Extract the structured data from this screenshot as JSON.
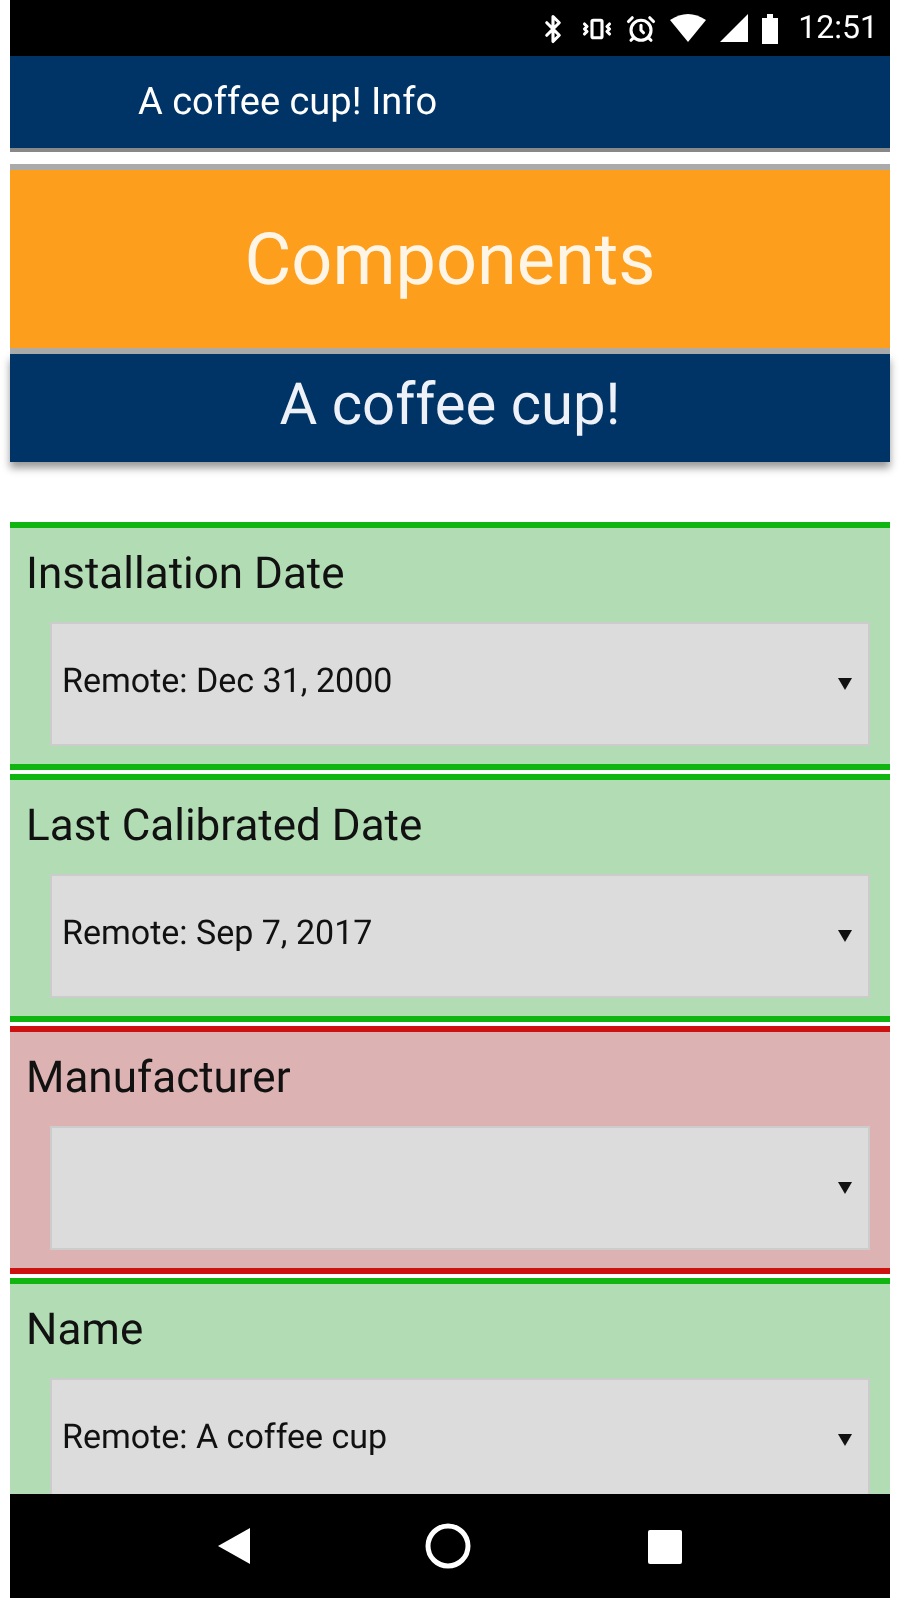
{
  "status_bar": {
    "time": "12:51"
  },
  "app_bar": {
    "title": "A coffee cup! Info"
  },
  "category_banner": {
    "title": "Components"
  },
  "item_banner": {
    "title": "A coffee cup!"
  },
  "fields": [
    {
      "label": "Installation Date",
      "value": "Remote: Dec 31, 2000",
      "valid": true
    },
    {
      "label": "Last Calibrated Date",
      "value": "Remote: Sep 7, 2017",
      "valid": true
    },
    {
      "label": "Manufacturer",
      "valid": false
    },
    {
      "label": "Name",
      "value": "Remote: A coffee cup",
      "valid": true
    }
  ]
}
